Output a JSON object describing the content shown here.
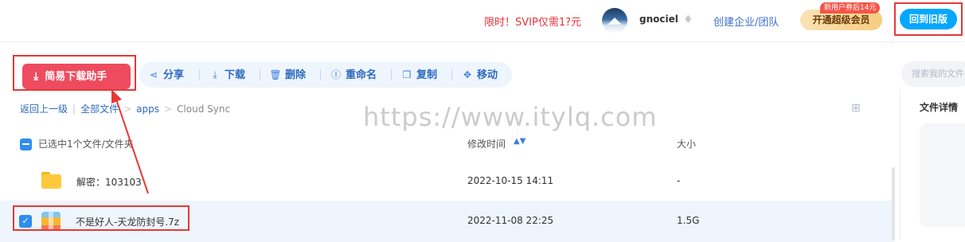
{
  "header": {
    "promo": "限时！SVIP仅需1?元",
    "username": "gnociel",
    "create_org": "创建企业/团队",
    "vip_button": "开通超级会员",
    "vip_badge": "新用户券后14元",
    "old_version": "回到旧版"
  },
  "toolbar": {
    "download_helper": "简易下载助手",
    "share": "分享",
    "download": "下载",
    "delete": "删除",
    "rename": "重命名",
    "copy": "复制",
    "move": "移动",
    "search_placeholder": "搜索我的文件"
  },
  "breadcrumb": {
    "back": "返回上一级",
    "all": "全部文件",
    "apps": "apps",
    "current": "Cloud Sync"
  },
  "table": {
    "selection_summary": "已选中1个文件/文件夹",
    "col_modified": "修改时间",
    "col_size": "大小",
    "rows": [
      {
        "name": "解密：103103",
        "modified": "2022-10-15 14:11",
        "size": "-",
        "type": "folder",
        "selected": false
      },
      {
        "name": "不是好人-天龙防封号.7z",
        "modified": "2022-11-08 22:25",
        "size": "1.5G",
        "type": "archive",
        "selected": true
      }
    ]
  },
  "detail_panel": {
    "title": "文件详情"
  },
  "watermark": "https://www.itylq.com",
  "colors": {
    "accent": "#06a7ff",
    "annotation_red": "#e53935",
    "download_button": "#ef4b5f",
    "link_blue": "#2e6bbf"
  }
}
